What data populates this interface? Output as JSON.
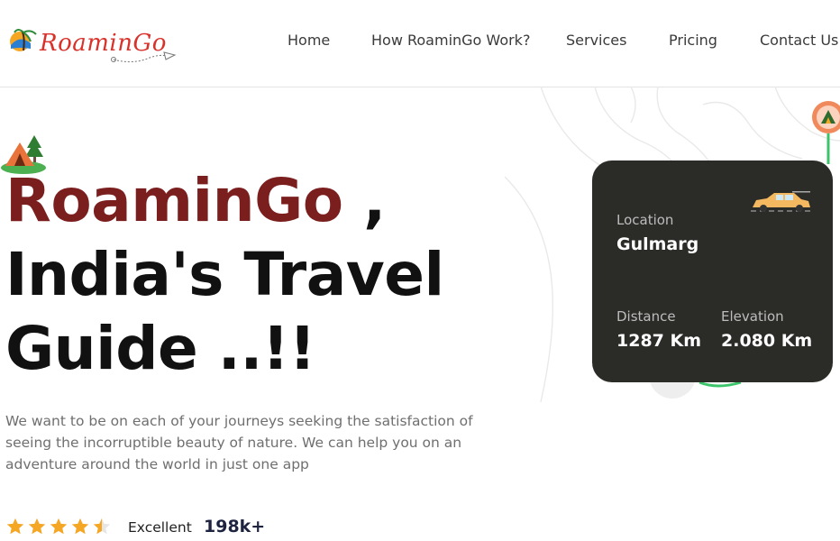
{
  "brand": {
    "name": "RoaminGo"
  },
  "nav": {
    "items": [
      {
        "label": "Home"
      },
      {
        "label": "How RoaminGo Work?"
      },
      {
        "label": "Services"
      },
      {
        "label": "Pricing"
      },
      {
        "label": "Contact Us"
      }
    ]
  },
  "hero": {
    "brand_word": "RoaminGo",
    "brand_suffix": " ,",
    "line2": "India's Travel",
    "line3": "Guide ..!!",
    "description": "We want to be on each of your journeys seeking the satisfaction of seeing the incorruptible beauty of nature. We can help you on an adventure around the world in just one app"
  },
  "rating": {
    "stars": 4.5,
    "max_stars": 5,
    "label": "Excellent",
    "count": "198k+"
  },
  "card": {
    "location_label": "Location",
    "location_value": "Gulmarg",
    "distance_label": "Distance",
    "distance_value": "1287 Km",
    "elevation_label": "Elevation",
    "elevation_value": "2.080 Km"
  },
  "colors": {
    "brand_red": "#7b1e1e",
    "logo_red": "#d8322b",
    "card_bg": "#2b2b28",
    "star": "#f5a623",
    "pin": "#f08a5d",
    "route": "#3cc46a"
  },
  "icons": [
    "logo-mark-icon",
    "paper-plane-icon",
    "tent-icon",
    "car-icon",
    "map-pin-icon",
    "star-icon"
  ]
}
